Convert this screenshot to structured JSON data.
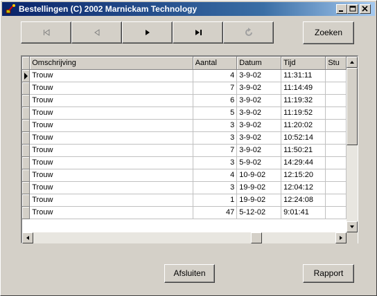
{
  "window": {
    "title": "Bestellingen (C) 2002 Marnickam Technology"
  },
  "nav": {
    "first": "first-record",
    "prev": "previous-record",
    "next": "next-record",
    "last": "last-record",
    "refresh": "refresh"
  },
  "buttons": {
    "search": "Zoeken",
    "close": "Afsluiten",
    "report": "Rapport"
  },
  "table": {
    "columns": [
      "Omschrijving",
      "Aantal",
      "Datum",
      "Tijd",
      "Stu"
    ],
    "rows": [
      [
        "Trouw",
        "4",
        "3-9-02",
        "11:31:11",
        ""
      ],
      [
        "Trouw",
        "7",
        "3-9-02",
        "11:14:49",
        ""
      ],
      [
        "Trouw",
        "6",
        "3-9-02",
        "11:19:32",
        ""
      ],
      [
        "Trouw",
        "5",
        "3-9-02",
        "11:19:52",
        ""
      ],
      [
        "Trouw",
        "3",
        "3-9-02",
        "11:20:02",
        ""
      ],
      [
        "Trouw",
        "3",
        "3-9-02",
        "10:52:14",
        ""
      ],
      [
        "Trouw",
        "7",
        "3-9-02",
        "11:50:21",
        ""
      ],
      [
        "Trouw",
        "3",
        "5-9-02",
        "14:29:44",
        ""
      ],
      [
        "Trouw",
        "4",
        "10-9-02",
        "12:15:20",
        ""
      ],
      [
        "Trouw",
        "3",
        "19-9-02",
        "12:04:12",
        ""
      ],
      [
        "Trouw",
        "1",
        "19-9-02",
        "12:24:08",
        ""
      ],
      [
        "Trouw",
        "47",
        "5-12-02",
        "9:01:41",
        ""
      ]
    ],
    "current_row": 0
  }
}
